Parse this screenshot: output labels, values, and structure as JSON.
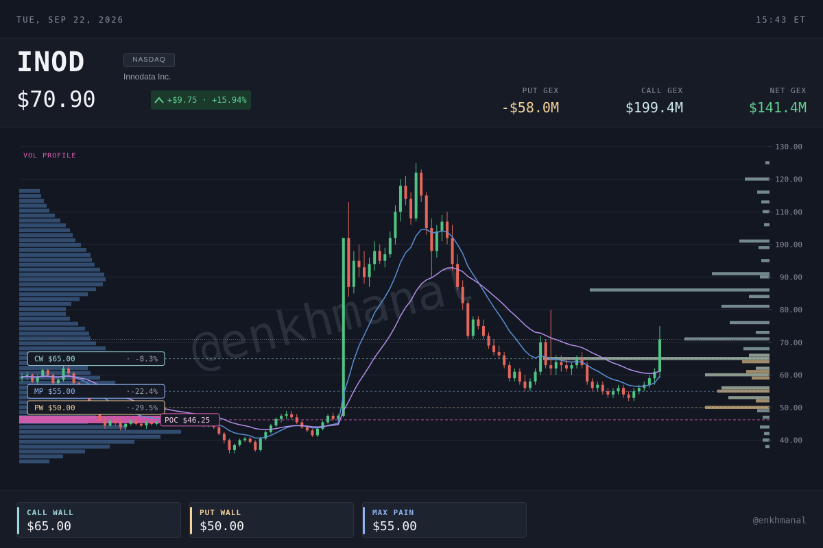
{
  "topbar": {
    "date": "TUE, SEP 22, 2026",
    "time": "15:43 ET"
  },
  "header": {
    "ticker": "INOD",
    "exchange": "NASDAQ",
    "company": "Innodata Inc.",
    "price": "$70.90",
    "change": "+$9.75 · +15.94%",
    "gex": [
      {
        "label": "PUT GEX",
        "value": "-$58.0M",
        "color": "#f4d29a"
      },
      {
        "label": "CALL GEX",
        "value": "$199.4M",
        "color": "#cfe9ec"
      },
      {
        "label": "NET GEX",
        "value": "$141.4M",
        "color": "#5fcf8e"
      }
    ]
  },
  "colors": {
    "up": "#4fc485",
    "down": "#e5675c",
    "ma_fast": "#5b8fd6",
    "ma_slow": "#b48fe8",
    "call": "#9fd8dc",
    "put": "#f4d29a",
    "maxpain": "#8fb2f0",
    "poc": "#e05fb5",
    "profile": "#3e5f8a"
  },
  "chart_data": {
    "type": "candlestick",
    "watermark": "@enkhmanal",
    "profile_label": "VOL PROFILE",
    "y_ticks": [
      "130.00",
      "120.00",
      "110.00",
      "100.00",
      "90.00",
      "80.00",
      "70.00",
      "60.00",
      "50.00",
      "40.00"
    ],
    "ylim": [
      33,
      130
    ],
    "price_labels": [
      {
        "label": "CW $65.00",
        "pct": "· -8.3%",
        "price": 65,
        "kind": "call"
      },
      {
        "label": "MP $55.00",
        "pct": "·-22.4%",
        "price": 55,
        "kind": "maxpain"
      },
      {
        "label": "PW $50.00",
        "pct": "·-29.5%",
        "price": 50,
        "kind": "put"
      }
    ],
    "poc": {
      "label": "POC $46.25",
      "price": 46.25
    },
    "current_price": 70.9,
    "candles": [
      [
        59,
        60.5,
        58,
        59.5
      ],
      [
        59.5,
        61,
        58.5,
        60
      ],
      [
        60,
        60.5,
        57.5,
        58
      ],
      [
        58,
        60,
        57,
        59.5
      ],
      [
        59.5,
        62,
        59,
        61.5
      ],
      [
        61.5,
        62,
        59.5,
        60
      ],
      [
        60,
        60.5,
        57,
        57.5
      ],
      [
        57.5,
        59,
        56,
        58.5
      ],
      [
        58.5,
        63,
        58,
        62
      ],
      [
        62,
        63,
        60,
        60.5
      ],
      [
        60.5,
        61,
        57,
        57.5
      ],
      [
        57.5,
        58,
        54,
        54.5
      ],
      [
        54.5,
        56,
        53,
        55.5
      ],
      [
        55.5,
        56,
        51,
        51.5
      ],
      [
        51.5,
        52,
        48,
        48.5
      ],
      [
        48.5,
        49.5,
        45.5,
        46
      ],
      [
        46,
        47,
        43.5,
        44.5
      ],
      [
        44.5,
        46.5,
        44,
        46
      ],
      [
        46,
        47,
        44.5,
        45.5
      ],
      [
        45.5,
        46.5,
        43,
        44
      ],
      [
        44,
        45.5,
        43,
        45
      ],
      [
        45,
        46.5,
        44.5,
        46
      ],
      [
        46,
        47,
        44.5,
        45
      ],
      [
        45,
        46,
        44,
        44.5
      ],
      [
        44.5,
        46,
        43.5,
        45.5
      ],
      [
        45.5,
        46.5,
        44.5,
        45
      ],
      [
        45,
        46,
        44.5,
        45.5
      ],
      [
        45.5,
        46.5,
        45,
        46
      ],
      [
        46,
        47,
        45,
        45.5
      ],
      [
        45.5,
        46,
        44.5,
        45
      ],
      [
        45,
        46,
        44.5,
        45.5
      ],
      [
        45.5,
        46.5,
        45,
        46
      ],
      [
        46,
        46.5,
        45,
        45.5
      ],
      [
        45.5,
        46.5,
        44.5,
        45
      ],
      [
        45,
        46,
        44.5,
        45.5
      ],
      [
        45.5,
        46,
        44,
        44.5
      ],
      [
        44.5,
        45.5,
        44,
        45
      ],
      [
        45,
        45.5,
        43.5,
        44
      ],
      [
        44,
        44.5,
        41.5,
        42
      ],
      [
        42,
        42.5,
        39,
        40
      ],
      [
        40,
        40.5,
        36,
        37
      ],
      [
        37,
        39,
        36,
        38.5
      ],
      [
        38.5,
        40.5,
        38,
        40
      ],
      [
        40,
        41,
        39.5,
        40.5
      ],
      [
        40.5,
        41,
        39,
        39.5
      ],
      [
        39.5,
        40,
        36.5,
        37
      ],
      [
        37,
        41,
        36.5,
        40.5
      ],
      [
        40.5,
        43,
        40,
        42.5
      ],
      [
        42.5,
        45,
        42,
        44.5
      ],
      [
        44.5,
        47,
        44,
        46.5
      ],
      [
        46.5,
        48,
        45.5,
        47.5
      ],
      [
        47.5,
        49,
        46.5,
        48
      ],
      [
        48,
        49,
        46.5,
        47
      ],
      [
        47,
        48,
        45,
        45.5
      ],
      [
        45.5,
        46,
        43.5,
        44
      ],
      [
        44,
        44.5,
        42.5,
        43
      ],
      [
        43,
        43.5,
        41,
        41.5
      ],
      [
        41.5,
        44,
        41,
        43.5
      ],
      [
        43.5,
        46,
        43,
        45.5
      ],
      [
        45.5,
        48,
        45,
        47.5
      ],
      [
        47.5,
        48.5,
        46,
        46.5
      ],
      [
        46.5,
        48,
        45.5,
        47.5
      ],
      [
        47.5,
        73,
        47,
        102
      ],
      [
        102,
        113,
        84,
        87
      ],
      [
        87,
        98,
        85,
        95
      ],
      [
        95,
        100,
        90,
        93
      ],
      [
        93,
        98,
        88,
        90
      ],
      [
        90,
        96,
        87,
        94
      ],
      [
        94,
        101,
        92,
        98
      ],
      [
        98,
        100,
        94,
        95
      ],
      [
        95,
        99,
        93,
        97
      ],
      [
        97,
        104,
        96,
        102
      ],
      [
        102,
        112,
        100,
        110
      ],
      [
        110,
        120,
        107,
        118
      ],
      [
        118,
        121,
        112,
        114
      ],
      [
        114,
        116,
        106,
        108
      ],
      [
        108,
        125,
        107,
        122
      ],
      [
        122,
        123,
        113,
        115
      ],
      [
        115,
        116,
        103,
        105
      ],
      [
        105,
        108,
        90,
        98
      ],
      [
        98,
        106,
        96,
        104
      ],
      [
        104,
        109,
        101,
        107
      ],
      [
        107,
        110,
        100,
        102
      ],
      [
        102,
        106,
        92,
        94
      ],
      [
        94,
        97,
        86,
        87
      ],
      [
        87,
        89,
        80,
        82
      ],
      [
        82,
        83,
        71,
        72
      ],
      [
        72,
        78,
        71,
        77
      ],
      [
        77,
        78,
        74,
        75
      ],
      [
        75,
        77,
        71,
        72
      ],
      [
        72,
        73,
        68,
        69
      ],
      [
        69,
        71,
        66,
        67
      ],
      [
        67,
        69,
        65,
        66
      ],
      [
        66,
        67,
        62,
        63
      ],
      [
        63,
        64,
        58,
        59
      ],
      [
        59,
        62,
        58,
        61
      ],
      [
        61,
        62,
        57,
        58
      ],
      [
        58,
        60,
        55,
        56
      ],
      [
        56,
        59,
        55,
        58
      ],
      [
        58,
        62,
        57,
        61
      ],
      [
        61,
        72,
        60,
        70
      ],
      [
        70,
        71,
        62,
        63
      ],
      [
        63,
        80,
        60,
        62
      ],
      [
        62,
        66,
        60,
        64
      ],
      [
        64,
        66,
        61,
        63
      ],
      [
        63,
        65,
        61,
        62
      ],
      [
        62,
        64,
        60,
        63
      ],
      [
        63,
        66,
        62,
        65
      ],
      [
        65,
        67,
        62,
        63
      ],
      [
        63,
        64,
        57,
        58
      ],
      [
        58,
        59,
        55,
        56
      ],
      [
        56,
        58,
        55,
        57
      ],
      [
        57,
        58,
        54,
        55
      ],
      [
        55,
        56,
        53,
        54
      ],
      [
        54,
        56,
        53,
        55
      ],
      [
        55,
        57,
        54,
        56
      ],
      [
        56,
        57,
        53,
        54
      ],
      [
        54,
        55,
        52,
        53
      ],
      [
        53,
        56,
        52,
        55
      ],
      [
        55,
        57,
        54,
        56
      ],
      [
        56,
        58,
        55,
        57
      ],
      [
        57,
        60,
        56,
        59
      ],
      [
        59,
        62,
        57,
        61
      ],
      [
        61,
        75,
        59,
        70.9
      ]
    ],
    "profile_left": [
      30,
      32,
      36,
      40,
      44,
      52,
      60,
      68,
      74,
      78,
      82,
      90,
      98,
      104,
      106,
      110,
      118,
      124,
      126,
      122,
      112,
      100,
      88,
      76,
      68,
      68,
      74,
      86,
      96,
      102,
      104,
      112,
      126,
      130,
      124,
      110,
      100,
      104,
      118,
      140,
      178,
      170,
      158,
      152,
      144,
      128,
      112,
      100,
      156,
      236,
      206,
      168,
      132,
      96,
      64,
      44
    ],
    "profile_right": [
      {
        "p": 125,
        "w": 6,
        "k": "n"
      },
      {
        "p": 120,
        "w": 36,
        "k": "n"
      },
      {
        "p": 116,
        "w": 18,
        "k": "n"
      },
      {
        "p": 113,
        "w": 12,
        "k": "n"
      },
      {
        "p": 110,
        "w": 10,
        "k": "n"
      },
      {
        "p": 106,
        "w": 8,
        "k": "n"
      },
      {
        "p": 101,
        "w": 44,
        "k": "n"
      },
      {
        "p": 99,
        "w": 16,
        "k": "n"
      },
      {
        "p": 95,
        "w": 12,
        "k": "n"
      },
      {
        "p": 91,
        "w": 84,
        "k": "n"
      },
      {
        "p": 90,
        "w": 14,
        "k": "n"
      },
      {
        "p": 86,
        "w": 262,
        "k": "n"
      },
      {
        "p": 84,
        "w": 30,
        "k": "n"
      },
      {
        "p": 81,
        "w": 70,
        "k": "n"
      },
      {
        "p": 76,
        "w": 58,
        "k": "n"
      },
      {
        "p": 73,
        "w": 20,
        "k": "n"
      },
      {
        "p": 71,
        "w": 124,
        "k": "n"
      },
      {
        "p": 68,
        "w": 38,
        "k": "n"
      },
      {
        "p": 66,
        "w": 30,
        "k": "c"
      },
      {
        "p": 65,
        "w": 330,
        "k": "c"
      },
      {
        "p": 64,
        "w": 40,
        "k": "p"
      },
      {
        "p": 62,
        "w": 20,
        "k": "c"
      },
      {
        "p": 61,
        "w": 34,
        "k": "p"
      },
      {
        "p": 60,
        "w": 94,
        "k": "c"
      },
      {
        "p": 59,
        "w": 26,
        "k": "p"
      },
      {
        "p": 56,
        "w": 70,
        "k": "c"
      },
      {
        "p": 55,
        "w": 76,
        "k": "p"
      },
      {
        "p": 53,
        "w": 60,
        "k": "c"
      },
      {
        "p": 52,
        "w": 20,
        "k": "p"
      },
      {
        "p": 50,
        "w": 94,
        "k": "p"
      },
      {
        "p": 49,
        "w": 18,
        "k": "n"
      },
      {
        "p": 47,
        "w": 10,
        "k": "n"
      },
      {
        "p": 44,
        "w": 14,
        "k": "n"
      },
      {
        "p": 42,
        "w": 8,
        "k": "n"
      },
      {
        "p": 40,
        "w": 10,
        "k": "n"
      },
      {
        "p": 38,
        "w": 6,
        "k": "n"
      }
    ]
  },
  "footer": {
    "cards": [
      {
        "label": "CALL WALL",
        "value": "$65.00",
        "color": "#9fd8dc"
      },
      {
        "label": "PUT WALL",
        "value": "$50.00",
        "color": "#f4d29a"
      },
      {
        "label": "MAX PAIN",
        "value": "$55.00",
        "color": "#8fb2f0"
      }
    ],
    "handle": "@enkhmanal"
  }
}
